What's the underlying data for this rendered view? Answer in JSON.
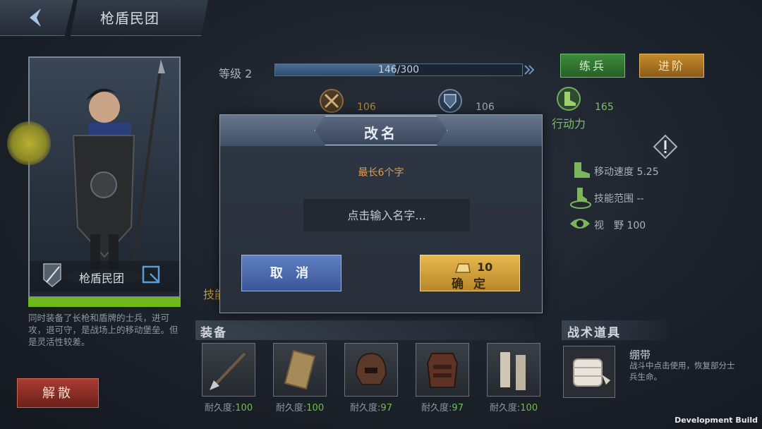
{
  "header": {
    "title": "枪盾民团"
  },
  "unit": {
    "portrait_name": "枪盾民团",
    "description": "同时装备了长枪和盾牌的士兵，进可攻，退可守，是战场上的移动堡垒。但是灵活性较差。",
    "disband_label": "解散"
  },
  "level": {
    "label": "等级 2",
    "xp_text": "146/300",
    "xp_fraction": 0.487
  },
  "actions": {
    "train_label": "练兵",
    "advance_label": "进阶"
  },
  "stats": {
    "attack": "106",
    "defense": "106",
    "action_label": "行动力",
    "action": "165"
  },
  "attributes": {
    "move_speed": "移动速度 5.25",
    "skill_range": "技能范围 --",
    "vision": "视　野 100"
  },
  "skill_label": "技能",
  "equipment": {
    "title": "装备",
    "durability_label": "耐久度:",
    "items": [
      {
        "icon": "spear-icon",
        "durability": "100"
      },
      {
        "icon": "shield-icon",
        "durability": "100"
      },
      {
        "icon": "helmet-icon",
        "durability": "97"
      },
      {
        "icon": "armor-icon",
        "durability": "97"
      },
      {
        "icon": "greaves-icon",
        "durability": "100"
      }
    ]
  },
  "tactics": {
    "title": "战术道具",
    "item_name": "绷带",
    "item_desc": "战斗中点击使用，恢复部分士兵生命。"
  },
  "rename_dialog": {
    "title": "改名",
    "hint": "最长6个字",
    "placeholder": "点击输入名字...",
    "cancel_label": "取 消",
    "confirm_label": "确 定",
    "confirm_cost": "10"
  },
  "footer": {
    "build": "Development Build"
  },
  "colors": {
    "accent_orange": "#e59a4a",
    "green_value": "#6fbf4a",
    "gold": "#b88a3c"
  }
}
